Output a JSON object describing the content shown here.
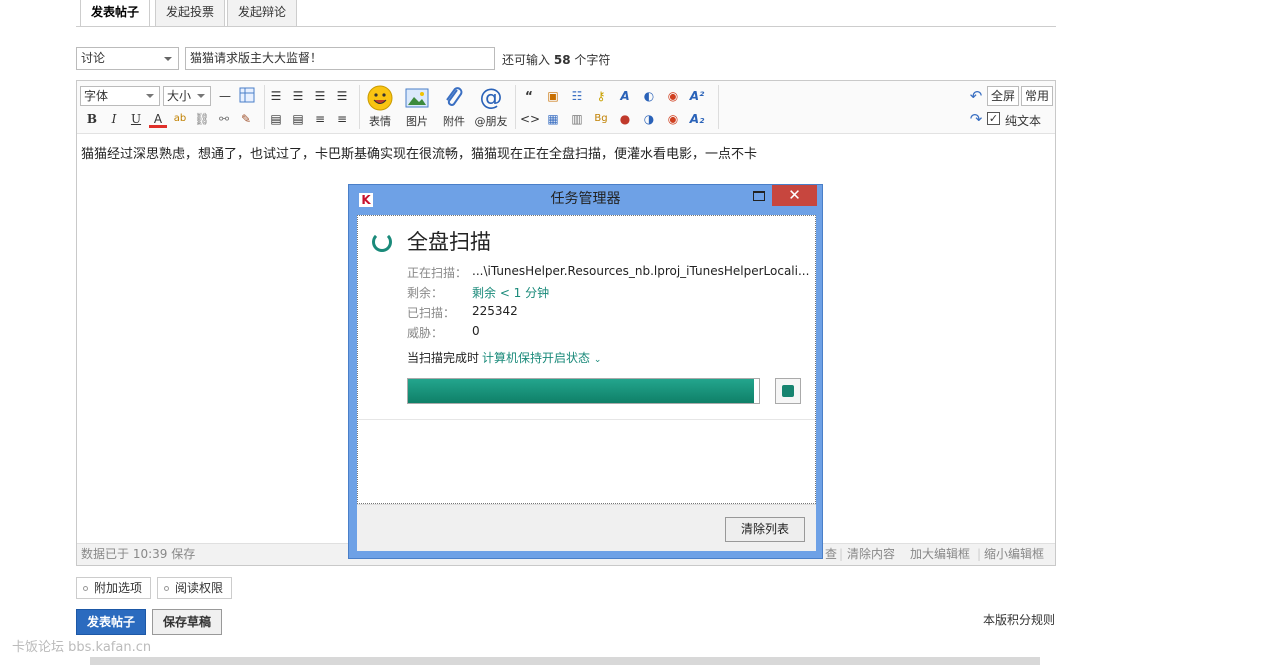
{
  "tabs": [
    "发表帖子",
    "发起投票",
    "发起辩论"
  ],
  "post": {
    "type_value": "讨论",
    "title_value": "猫猫请求版主大大监督！",
    "remain_prefix": "还可输入",
    "remain_count": "58",
    "remain_suffix": "个字符"
  },
  "toolbar": {
    "font_label": "字体",
    "size_label": "大小",
    "emoji_label": "表情",
    "image_label": "图片",
    "attach_label": "附件",
    "mention_label": "@朋友",
    "fullscreen_label": "全屏",
    "common_label": "常用",
    "plaintext_label": "纯文本"
  },
  "editor": {
    "content": "猫猫经过深思熟虑，想通了，也试过了，卡巴斯基确实现在很流畅，猫猫现在正在全盘扫描，便灌水看电影，一点不卡",
    "saved_status": "数据已于 10:39 保存",
    "status_links": [
      "查",
      "清除内容",
      "加大编辑框",
      "缩小编辑框"
    ]
  },
  "dialog": {
    "title": "任务管理器",
    "close_glyph": "✕",
    "scan_title": "全盘扫描",
    "scanning_label": "正在扫描：",
    "scanning_value": "...\\iTunesHelper.Resources_nb.lproj_iTunesHelperLocali...",
    "remaining_label": "剩余：",
    "remaining_value": "剩余 < 1 分钟",
    "scanned_label": "已扫描：",
    "scanned_value": "225342",
    "threats_label": "威胁：",
    "threats_value": "0",
    "finish_label": "当扫描完成时",
    "finish_option": "计算机保持开启状态",
    "progress": 0.985,
    "clear_label": "清除列表"
  },
  "bottom": {
    "extra_options": "附加选项",
    "read_permission": "阅读权限",
    "submit": "发表帖子",
    "save_draft": "保存草稿",
    "rules": "本版积分规则",
    "watermark": "卡饭论坛 bbs.kafan.cn"
  },
  "colors": {
    "accent_green": "#1a8a7a",
    "submit_blue": "#2b6bbf",
    "dialog_frame": "#6ea1e6",
    "close_red": "#c7463e"
  }
}
